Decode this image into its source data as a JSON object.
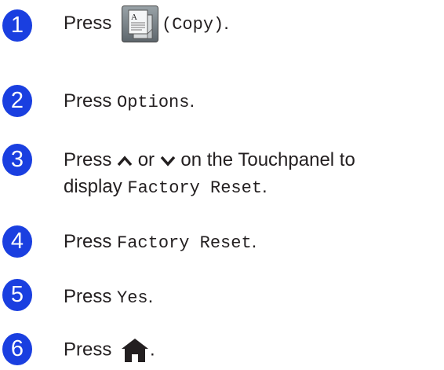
{
  "colors": {
    "step_badge": "#1a3fe0",
    "text": "#231f20"
  },
  "steps": [
    {
      "number": "1",
      "press": "Press",
      "icon": "copy-icon",
      "suffix": "(Copy)",
      "period": "."
    },
    {
      "number": "2",
      "press": "Press",
      "code": "Options",
      "period": "."
    },
    {
      "number": "3",
      "press": "Press",
      "icon_up": "chevron-up-icon",
      "or": "or",
      "icon_down": "chevron-down-icon",
      "text_after": "on the Touchpanel to",
      "line2_prefix": "display",
      "code": "Factory Reset",
      "period": "."
    },
    {
      "number": "4",
      "press": "Press",
      "code": "Factory Reset",
      "period": "."
    },
    {
      "number": "5",
      "press": "Press",
      "code": "Yes",
      "period": "."
    },
    {
      "number": "6",
      "press": "Press",
      "icon": "home-icon",
      "period": "."
    }
  ]
}
